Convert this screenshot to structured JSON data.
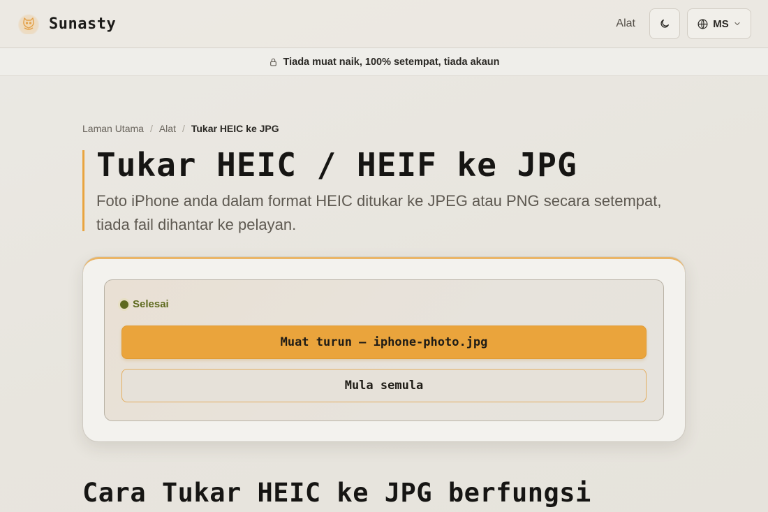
{
  "header": {
    "brand": "Sunasty",
    "nav_tools": "Alat",
    "language": "MS",
    "icons": {
      "logo": "cat-logo-icon",
      "theme": "moon-icon",
      "language": "globe-icon",
      "dropdown": "chevron-down-icon"
    }
  },
  "notice": {
    "text": "Tiada muat naik, 100% setempat, tiada akaun",
    "icon": "lock-icon"
  },
  "breadcrumb": {
    "home": "Laman Utama",
    "sep1": "/",
    "tools": "Alat",
    "sep2": "/",
    "current": "Tukar HEIC ke JPG"
  },
  "hero": {
    "title": "Tukar HEIC / HEIF ke JPG",
    "description": "Foto iPhone anda dalam format HEIC ditukar ke JPEG atau PNG secara setempat, tiada fail dihantar ke pelayan."
  },
  "converter": {
    "status": "Selesai",
    "download_label": "Muat turun — iphone-photo.jpg",
    "reset_label": "Mula semula"
  },
  "section": {
    "title": "Cara Tukar HEIC ke JPG berfungsi"
  },
  "colors": {
    "accent": "#eaa43c",
    "status_green": "#5e6a1f"
  }
}
